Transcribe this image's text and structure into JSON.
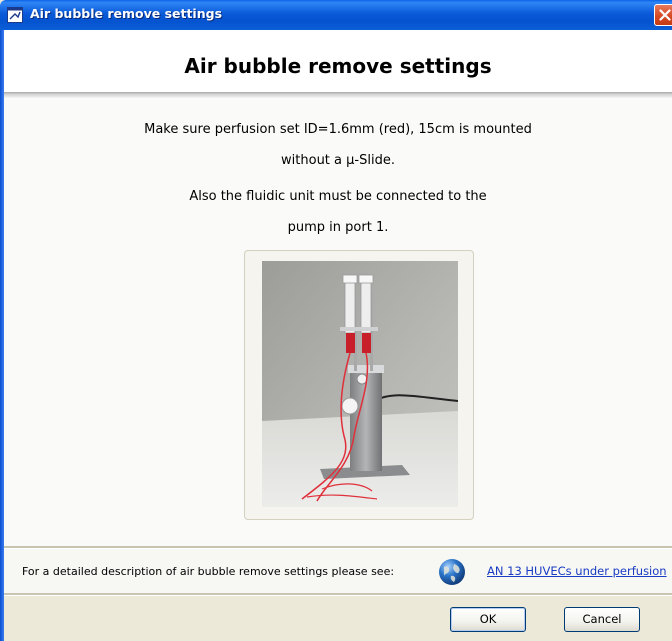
{
  "window": {
    "title": "Air bubble remove settings",
    "app_icon": "app-window-icon",
    "close_icon": "close-icon"
  },
  "header": {
    "title": "Air bubble remove settings"
  },
  "message": {
    "line1": "Make sure perfusion set ID=1.6mm (red), 15cm is mounted",
    "line2": "without a µ-Slide.",
    "line3": "Also the fluidic unit must be connected to the",
    "line4": "pump in port 1."
  },
  "photo": {
    "subject": "fluidic-unit-photo"
  },
  "info": {
    "text": "For a detailed description of air bubble remove settings please see:",
    "icon": "globe-icon",
    "link": "AN 13 HUVECs under perfusion"
  },
  "buttons": {
    "ok": "OK",
    "cancel": "Cancel"
  },
  "colors": {
    "titlebar": "#0a5ad9",
    "link": "#1a3cc2",
    "close": "#d64b25"
  }
}
